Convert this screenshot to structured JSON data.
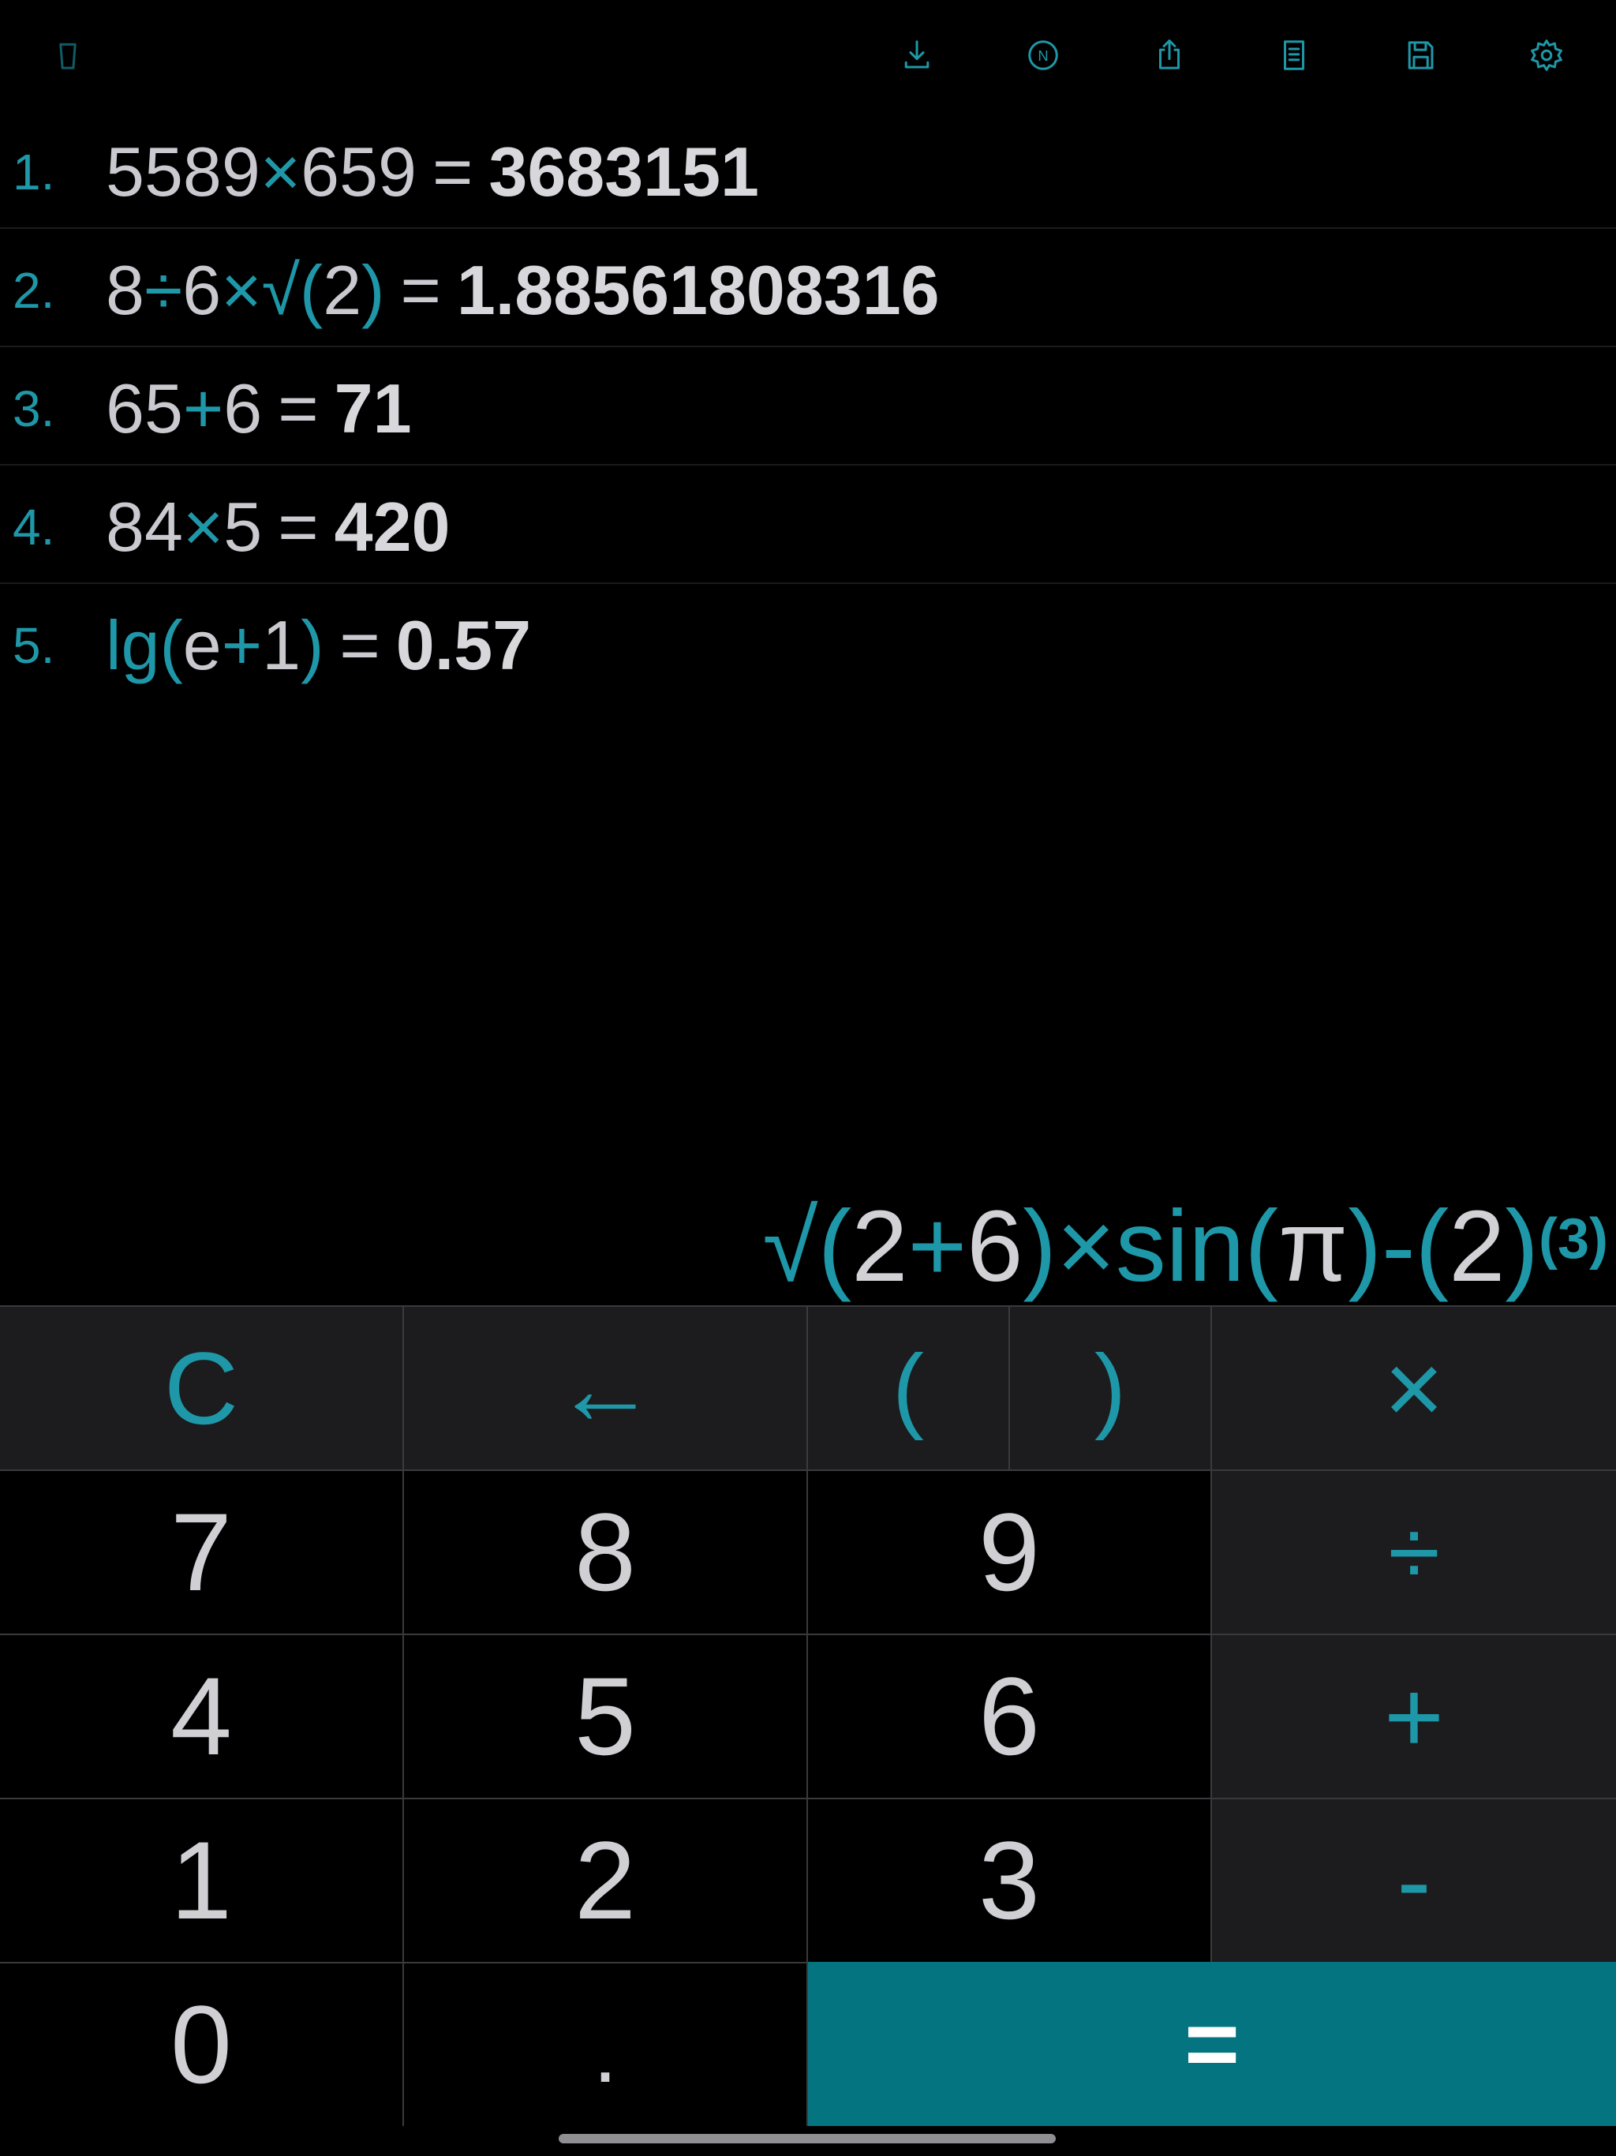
{
  "colors": {
    "accent": "#1e98a8",
    "equals_bg": "#047480",
    "function_key_bg": "#1c1c1e",
    "text": "#cfcfd4"
  },
  "toolbar": {
    "icons": [
      "trash-icon",
      "download-icon",
      "number-format-icon",
      "share-icon",
      "notes-icon",
      "save-icon",
      "gear-icon"
    ],
    "n_label": "N"
  },
  "history": [
    {
      "num": "1.",
      "expr": [
        {
          "t": "5589",
          "k": "num"
        },
        {
          "t": "×",
          "k": "op"
        },
        {
          "t": "659",
          "k": "num"
        }
      ],
      "eq": "=",
      "result": "3683151"
    },
    {
      "num": "2.",
      "expr": [
        {
          "t": "8",
          "k": "num"
        },
        {
          "t": "÷",
          "k": "op"
        },
        {
          "t": "6",
          "k": "num"
        },
        {
          "t": "×",
          "k": "op"
        },
        {
          "t": "√",
          "k": "fn"
        },
        {
          "t": "(",
          "k": "fn"
        },
        {
          "t": "2",
          "k": "num"
        },
        {
          "t": ")",
          "k": "fn"
        }
      ],
      "eq": "=",
      "result": "1.88561808316"
    },
    {
      "num": "3.",
      "expr": [
        {
          "t": "65",
          "k": "num"
        },
        {
          "t": "+",
          "k": "op"
        },
        {
          "t": "6",
          "k": "num"
        }
      ],
      "eq": "=",
      "result": "71"
    },
    {
      "num": "4.",
      "expr": [
        {
          "t": "84",
          "k": "num"
        },
        {
          "t": "×",
          "k": "op"
        },
        {
          "t": "5",
          "k": "num"
        }
      ],
      "eq": "=",
      "result": "420"
    },
    {
      "num": "5.",
      "expr": [
        {
          "t": "lg(",
          "k": "fn"
        },
        {
          "t": "e",
          "k": "num"
        },
        {
          "t": "+",
          "k": "op"
        },
        {
          "t": "1",
          "k": "num"
        },
        {
          "t": ")",
          "k": "fn"
        }
      ],
      "eq": "=",
      "result": "0.57"
    }
  ],
  "current": {
    "parts": [
      {
        "t": "√(",
        "k": "fn"
      },
      {
        "t": "2",
        "k": "num"
      },
      {
        "t": "+",
        "k": "op"
      },
      {
        "t": "6",
        "k": "num"
      },
      {
        "t": ")×sin(",
        "k": "fn"
      },
      {
        "t": "π",
        "k": "num"
      },
      {
        "t": ")-(",
        "k": "fn"
      },
      {
        "t": "2",
        "k": "num"
      },
      {
        "t": ")",
        "k": "fn"
      }
    ],
    "exponent": "(3)"
  },
  "keys": {
    "clear": "C",
    "backspace": "←",
    "open_paren": "(",
    "close_paren": ")",
    "multiply": "×",
    "divide": "÷",
    "plus": "+",
    "minus": "-",
    "equals": "=",
    "decimal": ".",
    "d0": "0",
    "d1": "1",
    "d2": "2",
    "d3": "3",
    "d4": "4",
    "d5": "5",
    "d6": "6",
    "d7": "7",
    "d8": "8",
    "d9": "9"
  }
}
